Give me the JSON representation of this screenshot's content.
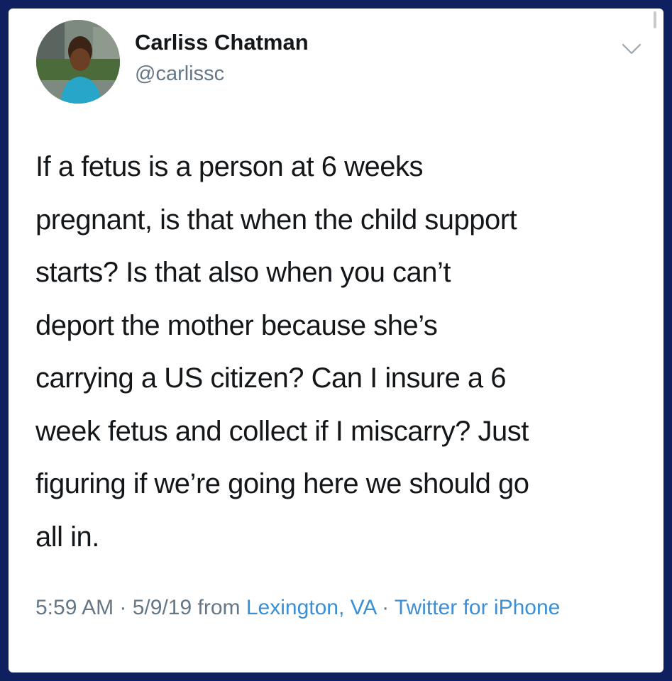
{
  "tweet": {
    "author": {
      "display_name": "Carliss Chatman",
      "handle": "@carlissc"
    },
    "text_lines": [
      "If a fetus is a person at 6 weeks",
      "pregnant, is that when the child support",
      "starts? Is that also when you can’t",
      "deport the mother because she’s",
      "carrying a US citizen? Can I insure a 6",
      "week fetus and collect if I miscarry? Just",
      "figuring if we’re going here we should go",
      "all in."
    ],
    "meta": {
      "time": "5:59 AM",
      "separator": " · ",
      "date": "5/9/19",
      "from_label": " from ",
      "location": "Lexington, VA",
      "separator2": " · ",
      "source": "Twitter for iPhone"
    }
  },
  "icons": {
    "more": "chevron-down-icon"
  },
  "colors": {
    "frame": "#0f2060",
    "text": "#14171a",
    "secondary": "#657786",
    "link": "#3b8fd4"
  }
}
